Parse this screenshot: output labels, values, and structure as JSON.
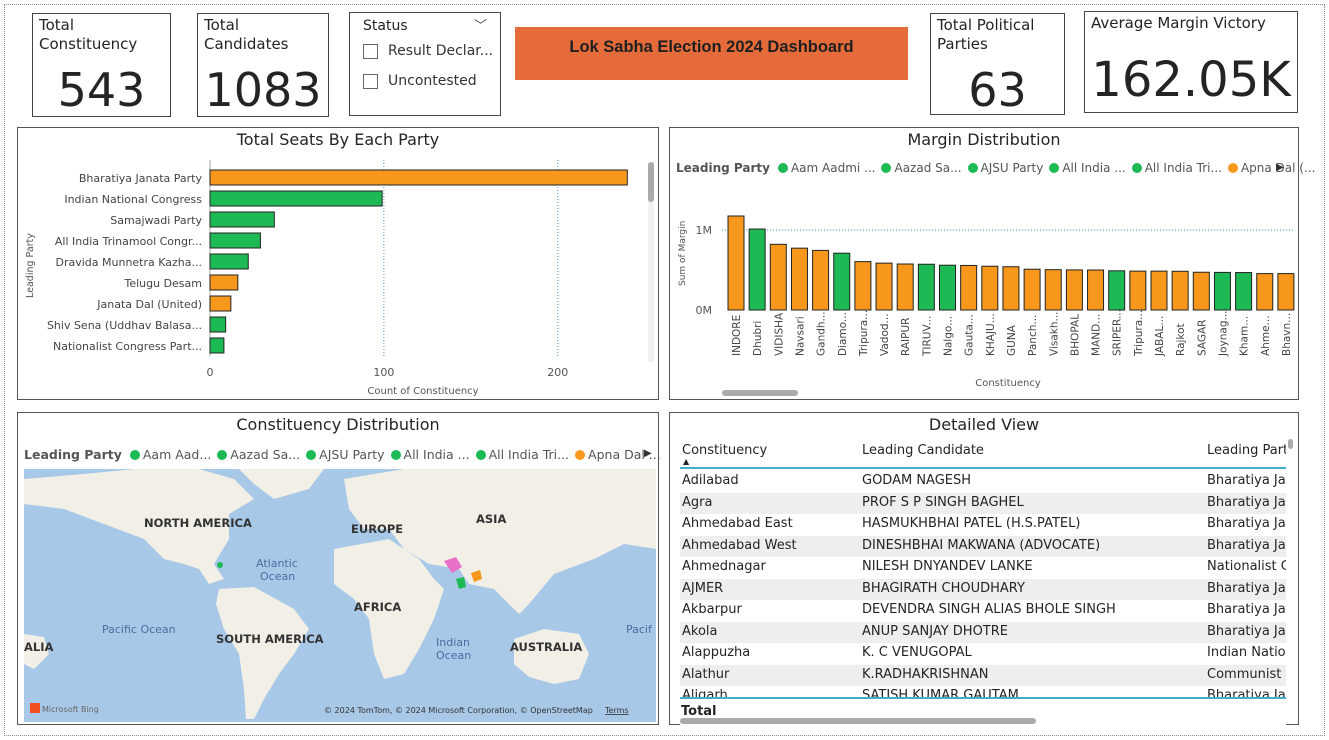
{
  "banner": "Lok Sabha Election 2024 Dashboard",
  "cards": {
    "total_constituency": {
      "label_line1": "Total",
      "label_line2": "Constituency",
      "value": "543"
    },
    "total_candidates": {
      "label_line1": "Total",
      "label_line2": "Candidates",
      "value": "1083"
    },
    "total_parties": {
      "label_line1": "Total Political",
      "label_line2": "Parties",
      "value": "63"
    },
    "avg_margin": {
      "label": "Average Margin Victory",
      "value": "162.05K"
    }
  },
  "slicer": {
    "title": "Status",
    "options": [
      "Result Declar...",
      "Uncontested"
    ]
  },
  "colors": {
    "orange": "#f7981d",
    "green": "#1db954",
    "gridline": "#4d8fd6",
    "banner": "#e56b3a"
  },
  "seats_chart": {
    "title": "Total Seats By Each Party",
    "ylabel": "Leading Party",
    "xlabel": "Count of Constituency",
    "ticks": [
      "0",
      "100",
      "200"
    ]
  },
  "margin_chart": {
    "title": "Margin Distribution",
    "legend_title": "Leading Party",
    "legend": [
      {
        "name": "Aam Aadmi ...",
        "color": "#1db954"
      },
      {
        "name": "Aazad Sa...",
        "color": "#1db954"
      },
      {
        "name": "AJSU Party",
        "color": "#1db954"
      },
      {
        "name": "All India ...",
        "color": "#1db954"
      },
      {
        "name": "All India Tri...",
        "color": "#1db954"
      },
      {
        "name": "Apna Dal (...",
        "color": "#f7981d"
      }
    ],
    "ylabel": "Sum of Margin",
    "xlabel": "Constituency",
    "yticks": [
      "1M",
      "0M"
    ]
  },
  "map": {
    "title": "Constituency Distribution",
    "legend_title": "Leading Party",
    "legend": [
      {
        "name": "Aam Aad...",
        "color": "#1db954"
      },
      {
        "name": "Aazad Sa...",
        "color": "#1db954"
      },
      {
        "name": "AJSU Party",
        "color": "#1db954"
      },
      {
        "name": "All India ...",
        "color": "#1db954"
      },
      {
        "name": "All India Tri...",
        "color": "#1db954"
      },
      {
        "name": "Apna Dal ...",
        "color": "#f7981d"
      }
    ],
    "labels": {
      "north_america": "NORTH AMERICA",
      "europe": "EUROPE",
      "asia": "ASIA",
      "atlantic1": "Atlantic",
      "atlantic2": "Ocean",
      "africa": "AFRICA",
      "pacific": "Pacific Ocean",
      "pacific_right": "Pacif",
      "south_america": "SOUTH AMERICA",
      "indian1": "Indian",
      "indian2": "Ocean",
      "australia": "AUSTRALIA",
      "alia": "ALIA",
      "bing": "Microsoft Bing",
      "copyright": "© 2024 TomTom, © 2024 Microsoft Corporation, © OpenStreetMap",
      "terms": "Terms"
    }
  },
  "table": {
    "title": "Detailed View",
    "columns": [
      "Constituency",
      "Leading Candidate",
      "Leading Party"
    ],
    "rows": [
      [
        "Adilabad",
        "GODAM NAGESH",
        "Bharatiya Jan"
      ],
      [
        "Agra",
        "PROF S P SINGH BAGHEL",
        "Bharatiya Jan"
      ],
      [
        "Ahmedabad East",
        "HASMUKHBHAI PATEL (H.S.PATEL)",
        "Bharatiya Jan"
      ],
      [
        "Ahmedabad West",
        "DINESHBHAI MAKWANA (ADVOCATE)",
        "Bharatiya Jan"
      ],
      [
        "Ahmednagar",
        "NILESH DNYANDEV LANKE",
        "Nationalist Co"
      ],
      [
        "AJMER",
        "BHAGIRATH CHOUDHARY",
        "Bharatiya Jan"
      ],
      [
        "Akbarpur",
        "DEVENDRA SINGH ALIAS BHOLE SINGH",
        "Bharatiya Jan"
      ],
      [
        "Akola",
        "ANUP SANJAY DHOTRE",
        "Bharatiya Jan"
      ],
      [
        "Alappuzha",
        "K. C VENUGOPAL",
        "Indian Nation"
      ],
      [
        "Alathur",
        "K.RADHAKRISHNAN",
        "Communist P"
      ],
      [
        "Aligarh",
        "SATISH KUMAR GAUTAM",
        "Bharatiya Jan"
      ]
    ],
    "total_label": "Total"
  },
  "chart_data": [
    {
      "type": "bar",
      "title": "Total Seats By Each Party",
      "xlabel": "Count of Constituency",
      "ylabel": "Leading Party",
      "categories": [
        "Bharatiya Janata Party",
        "Indian National Congress",
        "Samajwadi Party",
        "All India Trinamool Congr...",
        "Dravida Munnetra Kazha...",
        "Telugu Desam",
        "Janata Dal (United)",
        "Shiv Sena (Uddhav Balasa...",
        "Nationalist Congress Part..."
      ],
      "values": [
        240,
        99,
        37,
        29,
        22,
        16,
        12,
        9,
        8
      ],
      "bar_colors": [
        "#f7981d",
        "#1db954",
        "#1db954",
        "#1db954",
        "#1db954",
        "#f7981d",
        "#f7981d",
        "#1db954",
        "#1db954"
      ],
      "xlim": [
        0,
        240
      ],
      "xticks": [
        0,
        100,
        200
      ]
    },
    {
      "type": "bar",
      "title": "Margin Distribution",
      "xlabel": "Constituency",
      "ylabel": "Sum of Margin",
      "categories": [
        "INDORE",
        "Dhubri",
        "VIDISHA",
        "Navsari",
        "Gandh...",
        "Diamo...",
        "Tripura...",
        "Vadod...",
        "RAIPUR",
        "TIRUV...",
        "Nalgo...",
        "Gauta...",
        "KHAJU...",
        "GUNA",
        "Panch...",
        "Visakh...",
        "BHOPAL",
        "MAND...",
        "SRIPER...",
        "Tripura...",
        "JABAL...",
        "Rajkot",
        "SAGAR",
        "Joynag...",
        "Kham...",
        "Ahme...",
        "Bhavn..."
      ],
      "values": [
        1175000,
        1012000,
        821000,
        773000,
        745000,
        710000,
        605000,
        586000,
        575000,
        572000,
        560000,
        557000,
        547000,
        541000,
        510000,
        504000,
        501000,
        500000,
        490000,
        486000,
        486000,
        484000,
        472000,
        470000,
        468000,
        455000,
        455000
      ],
      "bar_colors": [
        "#f7981d",
        "#1db954",
        "#f7981d",
        "#f7981d",
        "#f7981d",
        "#1db954",
        "#f7981d",
        "#f7981d",
        "#f7981d",
        "#1db954",
        "#1db954",
        "#f7981d",
        "#f7981d",
        "#f7981d",
        "#f7981d",
        "#f7981d",
        "#f7981d",
        "#f7981d",
        "#1db954",
        "#f7981d",
        "#f7981d",
        "#f7981d",
        "#f7981d",
        "#1db954",
        "#1db954",
        "#f7981d",
        "#f7981d"
      ],
      "ylim": [
        0,
        1400000
      ],
      "yticks": [
        "0M",
        "1M"
      ]
    }
  ]
}
